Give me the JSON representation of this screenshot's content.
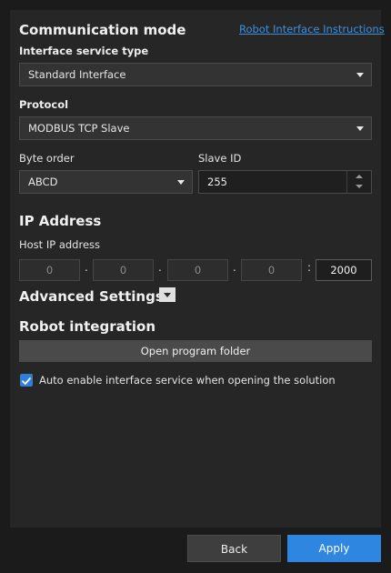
{
  "communication": {
    "title": "Communication mode",
    "instructions_link": "Robot Interface Instructions",
    "interface_service_type_label": "Interface service type",
    "interface_service_type_value": "Standard Interface",
    "protocol_label": "Protocol",
    "protocol_value": "MODBUS TCP Slave",
    "byte_order_label": "Byte order",
    "byte_order_value": "ABCD",
    "slave_id_label": "Slave ID",
    "slave_id_value": "255"
  },
  "ip": {
    "title": "IP Address",
    "host_label": "Host IP address",
    "octets": [
      "0",
      "0",
      "0",
      "0"
    ],
    "separator": ".",
    "port_separator": ":",
    "port": "2000"
  },
  "advanced": {
    "title": "Advanced Settings"
  },
  "robot_integration": {
    "title": "Robot integration",
    "open_folder_label": "Open program folder",
    "auto_enable_label": "Auto enable interface service when opening the solution",
    "auto_enable_checked": true
  },
  "footer": {
    "back_label": "Back",
    "apply_label": "Apply"
  },
  "colors": {
    "accent": "#2f86e0",
    "link": "#3d8fe0",
    "panel": "#262626",
    "background": "#1b1b1b"
  }
}
